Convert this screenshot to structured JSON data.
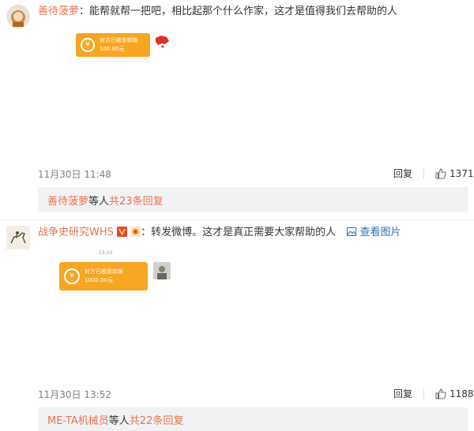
{
  "comments": [
    {
      "username": "善待菠萝",
      "text": "：能帮就帮一把吧，相比起那个什么作家，这才是值得我们去帮助的人",
      "transfer": {
        "status": "对方已收到转账",
        "amount": "100.00元"
      },
      "timestamp": "11月30日 11:48",
      "reply_label": "回复",
      "like_count": "1371",
      "reply_summary": {
        "user": "善待菠萝",
        "mid": " 等人 ",
        "count": "共23条回复"
      }
    },
    {
      "username": "战争史研究WHS",
      "text": "：转发微博。这才是真正需要大家帮助的人",
      "view_image": "查看图片",
      "time_label": "13:50",
      "transfer": {
        "status": "对方已收到转账",
        "amount": "1000.00元"
      },
      "timestamp": "11月30日 13:52",
      "reply_label": "回复",
      "like_count": "1188",
      "reply_summary": {
        "user": "ME-TA机械员",
        "mid": " 等人 ",
        "count": "共22条回复"
      }
    }
  ],
  "icons": {
    "like": "thumbs-up-icon",
    "image": "image-icon",
    "verified": "verified-v-icon",
    "vip": "vip-badge-icon"
  },
  "colors": {
    "username": "#eb7350",
    "link": "#2a6ebb",
    "transfer_card": "#f6a623",
    "reply_box": "#f2f2f5"
  }
}
